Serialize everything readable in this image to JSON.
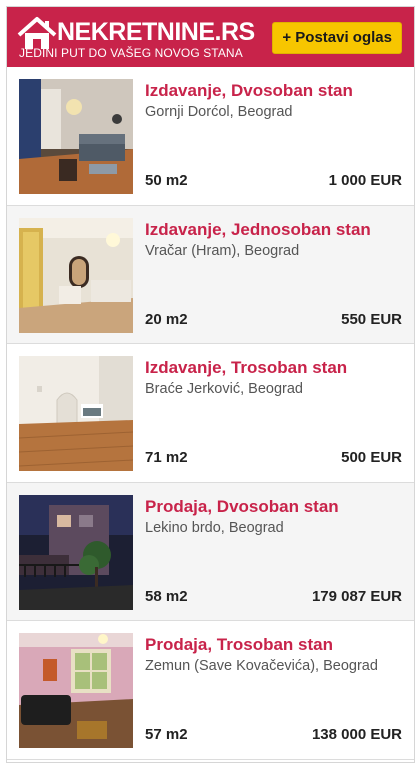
{
  "header": {
    "logo_text": "NEKRETNINE.RS",
    "tagline": "JEDINI PUT DO VAŠEG NOVOG STANA",
    "post_button": "+ Postavi oglas",
    "brand_color": "#c8234a",
    "button_color": "#f7c600"
  },
  "listings": [
    {
      "title": "Izdavanje, Dvosoban stan",
      "location": "Gornji Dorćol, Beograd",
      "area": "50 m2",
      "price": "1 000 EUR",
      "image": "living-room-photo"
    },
    {
      "title": "Izdavanje, Jednosoban stan",
      "location": "Vračar (Hram), Beograd",
      "area": "20 m2",
      "price": "550 EUR",
      "image": "studio-photo"
    },
    {
      "title": "Izdavanje, Trosoban stan",
      "location": "Braće Jerković, Beograd",
      "area": "71 m2",
      "price": "500 EUR",
      "image": "empty-room-photo"
    },
    {
      "title": "Prodaja, Dvosoban stan",
      "location": "Lekino brdo, Beograd",
      "area": "58 m2",
      "price": "179 087 EUR",
      "image": "exterior-night-photo"
    },
    {
      "title": "Prodaja, Trosoban stan",
      "location": "Zemun (Save Kovačevića), Beograd",
      "area": "57 m2",
      "price": "138 000 EUR",
      "image": "pink-room-photo"
    }
  ]
}
